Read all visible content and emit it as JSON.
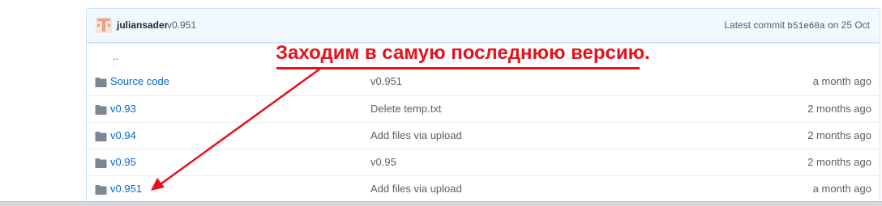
{
  "commit": {
    "author": "juliansader",
    "version": "v0.951",
    "latest_label": "Latest commit",
    "sha": "b51e60a",
    "date": "on 25 Oct"
  },
  "parent_link": "..",
  "rows": [
    {
      "name": "Source code",
      "message": "v0.951",
      "age": "a month ago",
      "icon": "folder-icon"
    },
    {
      "name": "v0.93",
      "message": "Delete temp.txt",
      "age": "2 months ago",
      "icon": "folder-icon"
    },
    {
      "name": "v0.94",
      "message": "Add files via upload",
      "age": "2 months ago",
      "icon": "folder-icon"
    },
    {
      "name": "v0.95",
      "message": "v0.95",
      "age": "2 months ago",
      "icon": "folder-icon"
    },
    {
      "name": "v0.951",
      "message": "Add files via upload",
      "age": "a month ago",
      "icon": "folder-icon"
    }
  ],
  "annotation": {
    "text": "Заходим в самую последнюю версию.",
    "color": "#e8101a"
  },
  "colors": {
    "link": "#0366d6",
    "header_bg": "#f1f8ff",
    "folder": "#79b8ff"
  }
}
